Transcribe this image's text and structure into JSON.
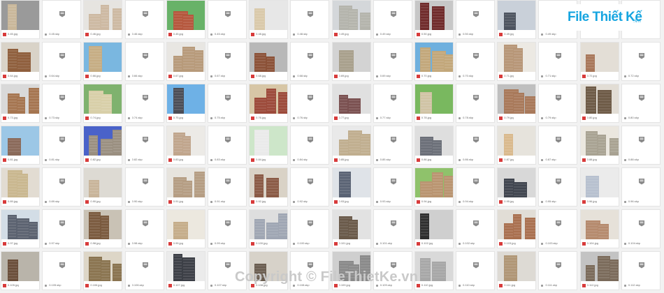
{
  "logo": {
    "brand": "File Thiết Kế",
    "domain": ".vn"
  },
  "watermark": "Copyright © FileThietKe.vn",
  "palette": {
    "image_icon": "#d83b3b",
    "file_icon": "#9a9a9a",
    "logo_blue": "#16a5e0",
    "logo_red": "#e2232a"
  },
  "grid": {
    "rows": [
      [
        {
          "t": "img",
          "name": "0.45.jpg",
          "bg": "#9a9a9a",
          "fg": "#c9b79a"
        },
        {
          "t": "file",
          "name": "0.45.skp"
        },
        {
          "t": "img",
          "name": "0.46.jpg",
          "bg": "#e6e4e0",
          "fg": "#cdb9a2"
        },
        {
          "t": "file",
          "name": "0.46.skp"
        },
        {
          "t": "img",
          "name": "0.45.jpg",
          "bg": "#68b268",
          "fg": "#b5573d"
        },
        {
          "t": "file",
          "name": "0.45.skp"
        },
        {
          "t": "img",
          "name": "0.48.jpg",
          "bg": "#e7e7e7",
          "fg": "#d9c9aa"
        },
        {
          "t": "file",
          "name": "0.48.skp"
        },
        {
          "t": "img",
          "name": "0.49.jpg",
          "bg": "#d4d7da",
          "fg": "#b4b4ac"
        },
        {
          "t": "file",
          "name": "0.49.skp"
        },
        {
          "t": "img",
          "name": "0.50.jpg",
          "bg": "#c7c7c7",
          "fg": "#6f2a2a"
        },
        {
          "t": "file",
          "name": "0.50.skp"
        },
        {
          "t": "img",
          "name": "0.49.jpg",
          "bg": "#c9d0d9",
          "fg": "#4d5460"
        },
        {
          "t": "file",
          "name": "0.49.skp"
        },
        {
          "t": "blank"
        },
        {
          "t": "blank"
        }
      ],
      [
        {
          "t": "img",
          "name": "0.64.jpg",
          "bg": "#d9d3c8",
          "fg": "#8f5f3d"
        },
        {
          "t": "file",
          "name": "0.64.skp"
        },
        {
          "t": "img",
          "name": "0.66.jpg",
          "bg": "#7ab7e0",
          "fg": "#c6ad84"
        },
        {
          "t": "file",
          "name": "0.66.skp"
        },
        {
          "t": "img",
          "name": "0.67.jpg",
          "bg": "#e8e6e2",
          "fg": "#b79a7a"
        },
        {
          "t": "file",
          "name": "0.67.skp"
        },
        {
          "t": "img",
          "name": "0.68.jpg",
          "bg": "#b8b8b8",
          "fg": "#8b5137"
        },
        {
          "t": "file",
          "name": "0.68.skp"
        },
        {
          "t": "img",
          "name": "0.69.jpg",
          "bg": "#d3d3d3",
          "fg": "#a8a08c"
        },
        {
          "t": "file",
          "name": "0.69.skp"
        },
        {
          "t": "img",
          "name": "0.70.jpg",
          "bg": "#6fb0de",
          "fg": "#c2a77a"
        },
        {
          "t": "file",
          "name": "0.70.skp"
        },
        {
          "t": "img",
          "name": "0.71.jpg",
          "bg": "#ece9e3",
          "fg": "#b79677"
        },
        {
          "t": "file",
          "name": "0.71.skp"
        },
        {
          "t": "img",
          "name": "0.72.jpg",
          "bg": "#e3ded6",
          "fg": "#a8775a"
        },
        {
          "t": "file",
          "name": "0.72.skp"
        }
      ],
      [
        {
          "t": "img",
          "name": "0.73.jpg",
          "bg": "#d9d9d9",
          "fg": "#a57550"
        },
        {
          "t": "file",
          "name": "0.73.skp"
        },
        {
          "t": "img",
          "name": "0.74.jpg",
          "bg": "#7fb26e",
          "fg": "#d8cfa8"
        },
        {
          "t": "file",
          "name": "0.74.skp"
        },
        {
          "t": "img",
          "name": "0.75.jpg",
          "bg": "#6eb1e6",
          "fg": "#4b4d56"
        },
        {
          "t": "file",
          "name": "0.75.skp"
        },
        {
          "t": "img",
          "name": "0.76.jpg",
          "bg": "#d7c6a6",
          "fg": "#9c4a3a"
        },
        {
          "t": "file",
          "name": "0.76.skp"
        },
        {
          "t": "img",
          "name": "0.77.jpg",
          "bg": "#e0e0e0",
          "fg": "#7a5050"
        },
        {
          "t": "file",
          "name": "0.77.skp"
        },
        {
          "t": "img",
          "name": "0.78.jpg",
          "bg": "#79b85f",
          "fg": "#d0c3a4"
        },
        {
          "t": "file",
          "name": "0.78.skp"
        },
        {
          "t": "img",
          "name": "0.79.jpg",
          "bg": "#bfbfbf",
          "fg": "#a8795a"
        },
        {
          "t": "file",
          "name": "0.79.skp"
        },
        {
          "t": "img",
          "name": "0.80.jpg",
          "bg": "#e2ddd5",
          "fg": "#6d5a46"
        },
        {
          "t": "file",
          "name": "0.80.skp"
        }
      ],
      [
        {
          "t": "img",
          "name": "0.81.jpg",
          "bg": "#9cc7e6",
          "fg": "#8a6a5a"
        },
        {
          "t": "file",
          "name": "0.81.skp"
        },
        {
          "t": "img",
          "name": "0.82.jpg",
          "bg": "#4a62c9",
          "fg": "#9a8f80"
        },
        {
          "t": "file",
          "name": "0.82.skp"
        },
        {
          "t": "img",
          "name": "0.83.jpg",
          "bg": "#eceae6",
          "fg": "#c0a58c"
        },
        {
          "t": "file",
          "name": "0.83.skp"
        },
        {
          "t": "img",
          "name": "0.84.jpg",
          "bg": "#cde6c9",
          "fg": "#eaeaea"
        },
        {
          "t": "file",
          "name": "0.84.skp"
        },
        {
          "t": "img",
          "name": "0.85.jpg",
          "bg": "#e9e9e9",
          "fg": "#c0ae8f"
        },
        {
          "t": "file",
          "name": "0.85.skp"
        },
        {
          "t": "img",
          "name": "0.86.jpg",
          "bg": "#dedede",
          "fg": "#6b6f78"
        },
        {
          "t": "file",
          "name": "0.86.skp"
        },
        {
          "t": "img",
          "name": "0.87.jpg",
          "bg": "#e6e3dc",
          "fg": "#d9b98c"
        },
        {
          "t": "file",
          "name": "0.87.skp"
        },
        {
          "t": "img",
          "name": "0.88.jpg",
          "bg": "#ebe7df",
          "fg": "#a8a292"
        },
        {
          "t": "file",
          "name": "0.88.skp"
        }
      ],
      [
        {
          "t": "img",
          "name": "0.89.jpg",
          "bg": "#e2dcd2",
          "fg": "#c9b78f"
        },
        {
          "t": "file",
          "name": "0.89.skp"
        },
        {
          "t": "img",
          "name": "0.90.jpg",
          "bg": "#dddad3",
          "fg": "#c8b49a"
        },
        {
          "t": "file",
          "name": "0.90.skp"
        },
        {
          "t": "img",
          "name": "0.91.jpg",
          "bg": "#e7e4de",
          "fg": "#b59d83"
        },
        {
          "t": "file",
          "name": "0.91.skp"
        },
        {
          "t": "img",
          "name": "0.92.jpg",
          "bg": "#d9d2c6",
          "fg": "#8a5a45"
        },
        {
          "t": "file",
          "name": "0.92.skp"
        },
        {
          "t": "img",
          "name": "0.93.jpg",
          "bg": "#dfe3e8",
          "fg": "#5a6374"
        },
        {
          "t": "file",
          "name": "0.93.skp"
        },
        {
          "t": "img",
          "name": "0.94.jpg",
          "bg": "#8fc26b",
          "fg": "#b99470"
        },
        {
          "t": "file",
          "name": "0.94.skp"
        },
        {
          "t": "img",
          "name": "0.95.jpg",
          "bg": "#d8d8d8",
          "fg": "#40454f"
        },
        {
          "t": "file",
          "name": "0.95.skp"
        },
        {
          "t": "img",
          "name": "0.96.jpg",
          "bg": "#ebebeb",
          "fg": "#b7c0cf"
        },
        {
          "t": "file",
          "name": "0.96.skp"
        }
      ],
      [
        {
          "t": "img",
          "name": "0.97.jpg",
          "bg": "#d3dde6",
          "fg": "#5b6270"
        },
        {
          "t": "file",
          "name": "0.97.skp"
        },
        {
          "t": "img",
          "name": "0.98.jpg",
          "bg": "#c9c2b5",
          "fg": "#7a5a3e"
        },
        {
          "t": "file",
          "name": "0.98.skp"
        },
        {
          "t": "img",
          "name": "0.99.jpg",
          "bg": "#ece8df",
          "fg": "#c5ad8a"
        },
        {
          "t": "file",
          "name": "0.99.skp"
        },
        {
          "t": "img",
          "name": "0.100.jpg",
          "bg": "#dedede",
          "fg": "#9fa6b3"
        },
        {
          "t": "file",
          "name": "0.100.skp"
        },
        {
          "t": "img",
          "name": "0.101.jpg",
          "bg": "#e2e2e2",
          "fg": "#6a5a4a"
        },
        {
          "t": "file",
          "name": "0.101.skp"
        },
        {
          "t": "img",
          "name": "0.102.jpg",
          "bg": "#cfcfcf",
          "fg": "#2e2e2e"
        },
        {
          "t": "file",
          "name": "0.102.skp"
        },
        {
          "t": "img",
          "name": "0.103.jpg",
          "bg": "#e1ddd6",
          "fg": "#a9704f"
        },
        {
          "t": "file",
          "name": "0.103.skp"
        },
        {
          "t": "img",
          "name": "0.104.jpg",
          "bg": "#e6e1d9",
          "fg": "#b58a6d"
        },
        {
          "t": "file",
          "name": "0.104.skp"
        }
      ],
      [
        {
          "t": "img",
          "name": "0.105.jpg",
          "bg": "#b9b4aa",
          "fg": "#6a4e3a"
        },
        {
          "t": "file",
          "name": "0.105.skp"
        },
        {
          "t": "img",
          "name": "0.106.jpg",
          "bg": "#ddd6c7",
          "fg": "#8a7450"
        },
        {
          "t": "file",
          "name": "0.106.skp"
        },
        {
          "t": "img",
          "name": "0.107.jpg",
          "bg": "#ebebeb",
          "fg": "#3c3f46"
        },
        {
          "t": "file",
          "name": "0.107.skp"
        },
        {
          "t": "img",
          "name": "0.108.jpg",
          "bg": "#d7d2c9",
          "fg": "#6a5d50"
        },
        {
          "t": "file",
          "name": "0.108.skp"
        },
        {
          "t": "img",
          "name": "0.109.jpg",
          "bg": "#cfcfcf",
          "fg": "#8a8a8a"
        },
        {
          "t": "file",
          "name": "0.109.skp"
        },
        {
          "t": "img",
          "name": "0.110.jpg",
          "bg": "#d9d9d9",
          "fg": "#a7a7a7"
        },
        {
          "t": "file",
          "name": "0.110.skp"
        },
        {
          "t": "img",
          "name": "0.111.jpg",
          "bg": "#dddad4",
          "fg": "#b09676"
        },
        {
          "t": "file",
          "name": "0.111.skp"
        },
        {
          "t": "img",
          "name": "0.112.jpg",
          "bg": "#c3c3c3",
          "fg": "#7a6a5a"
        },
        {
          "t": "file",
          "name": "0.112.skp"
        }
      ]
    ]
  }
}
